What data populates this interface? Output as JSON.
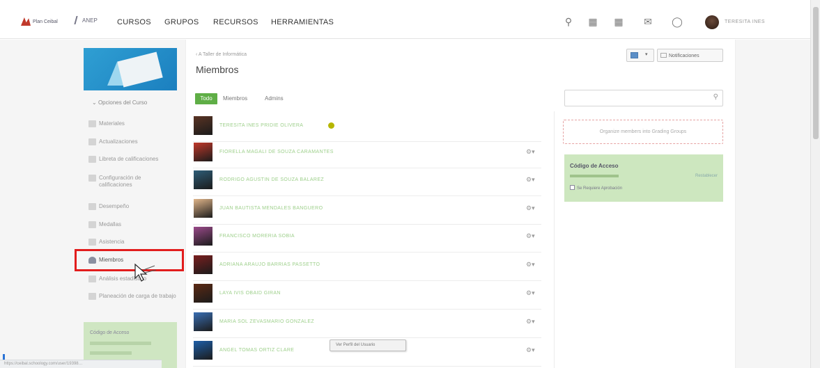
{
  "topbar": {
    "logo1": "Plan Ceibal",
    "logo2": "ANEP",
    "nav": [
      "CURSOS",
      "GRUPOS",
      "RECURSOS",
      "HERRAMIENTAS"
    ],
    "icons": [
      "search-icon",
      "apps-grid-icon",
      "calendar-icon",
      "mail-icon",
      "bell-icon"
    ],
    "user_name": "TERESITA INES"
  },
  "sidebar": {
    "course_options": "Opciones del Curso",
    "items": [
      {
        "label": "Materiales",
        "icon": "materials-icon"
      },
      {
        "label": "Actualizaciones",
        "icon": "updates-icon"
      },
      {
        "label": "Libreta de calificaciones",
        "icon": "gradebook-icon"
      },
      {
        "label": "Configuración de calificaciones",
        "icon": "grade-setup-icon"
      },
      {
        "label": "Desempeño",
        "icon": "mastery-icon"
      },
      {
        "label": "Medallas",
        "icon": "badges-icon"
      },
      {
        "label": "Asistencia",
        "icon": "attendance-icon"
      },
      {
        "label": "Miembros",
        "icon": "members-icon"
      },
      {
        "label": "Análisis estadístico",
        "icon": "analytics-icon"
      },
      {
        "label": "Planeación de carga de trabajo",
        "icon": "workload-icon"
      }
    ],
    "access_title": "Código de Acceso"
  },
  "main": {
    "breadcrumb": "‹ A Taller de Informática",
    "title": "Miembros",
    "notifications_label": "Notificaciones",
    "filters": {
      "all": "Todo",
      "members": "Miembros",
      "admins": "Admins"
    },
    "members": [
      {
        "name": "TERESITA INES PRIDIE OLIVERA",
        "avatar": "#5a3424",
        "admin": true
      },
      {
        "name": "FIORELLA MAGALI DE SOUZA CARAMANTES",
        "avatar": "#c0392b"
      },
      {
        "name": "RODRIGO AGUSTIN DE SOUZA BALAREZ",
        "avatar": "#2e5d78"
      },
      {
        "name": "JUAN BAUTISTA MENDALES BANGUERO",
        "avatar": "#e0b58a"
      },
      {
        "name": "FRANCISCO MORERIA SOBIA",
        "avatar": "#9a4a8a"
      },
      {
        "name": "ADRIANA ARAUJO BARRIAS PASSETTO",
        "avatar": "#7a1f1f"
      },
      {
        "name": "LAYA IVIS OBAID GIRAN",
        "avatar": "#5c2a14"
      },
      {
        "name": "MARIA SOL ZEVASMARIO GONZALEZ",
        "avatar": "#3a6fb3"
      },
      {
        "name": "ANGEL TOMAS ORTIZ CLARE",
        "avatar": "#1e5fa8"
      }
    ],
    "tooltip": "Ver Perfil del Usuario"
  },
  "right": {
    "grading_groups": "Organize members into Grading Groups",
    "access_code_title": "Código de Acceso",
    "reset_label": "Restablecer",
    "require_approval": "Se Requiere Aprobación"
  },
  "status_url": "https://ceibal.schoology.com/user/19398…"
}
